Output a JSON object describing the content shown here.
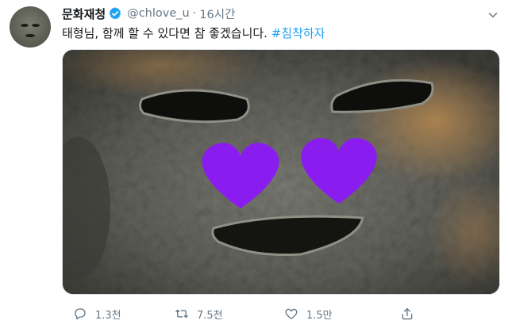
{
  "tweet": {
    "author": {
      "display_name": "문화재청",
      "verified": true,
      "handle": "@chlove_u",
      "separator": "·",
      "time": "16시간"
    },
    "text": {
      "body": "태형님, 함께 할 수 있다면 참 좋겠습니다. ",
      "hashtag": "#침착하자"
    },
    "actions": {
      "reply_count": "1.3천",
      "retweet_count": "7.5천",
      "like_count": "1.5만"
    }
  },
  "colors": {
    "accent": "#1da1f2",
    "muted": "#657786",
    "heart_overlay": "#8a1cf0"
  },
  "icons": [
    "avatar-image",
    "verified-badge-icon",
    "caret-down-icon",
    "reply-icon",
    "retweet-icon",
    "like-icon",
    "share-icon"
  ]
}
